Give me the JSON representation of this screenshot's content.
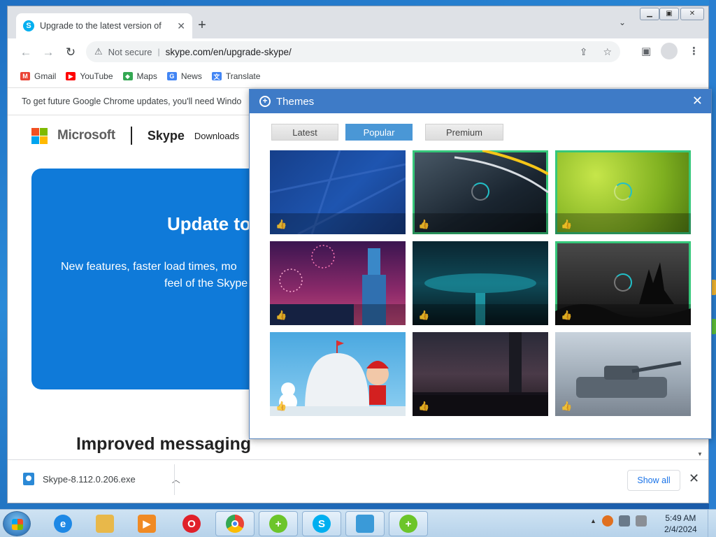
{
  "browser": {
    "tab_title": "Upgrade to the latest version of",
    "new_tab_label": "+",
    "tab_search_label": "⌄",
    "url_security": "Not secure",
    "url": "skype.com/en/upgrade-skype/",
    "bookmarks": [
      {
        "label": "Gmail",
        "color": "#ea4335",
        "glyph": "M"
      },
      {
        "label": "YouTube",
        "color": "#ff0000",
        "glyph": "▶"
      },
      {
        "label": "Maps",
        "color": "#34a853",
        "glyph": "◆"
      },
      {
        "label": "News",
        "color": "#4285f4",
        "glyph": "G"
      },
      {
        "label": "Translate",
        "color": "#4285f4",
        "glyph": "文"
      }
    ],
    "infobar_text": "To get future Google Chrome updates, you'll need Windo"
  },
  "webpage": {
    "brand": "Microsoft",
    "product": "Skype",
    "nav_downloads": "Downloads",
    "hero_title": "Update to",
    "hero_line1": "New features, faster load times, mo",
    "hero_line2": "feel of the Skype",
    "section_title": "Improved messaging"
  },
  "download_bar": {
    "file_name": "Skype-8.112.0.206.exe",
    "show_all": "Show all"
  },
  "themes_dialog": {
    "title": "Themes",
    "tabs": [
      "Latest",
      "Popular",
      "Premium"
    ],
    "active_tab": "Popular",
    "thumbnails": [
      {
        "name": "blue-lines",
        "selected": false,
        "loading": false
      },
      {
        "name": "dark-road",
        "selected": true,
        "loading": true
      },
      {
        "name": "green-meadow",
        "selected": true,
        "loading": true
      },
      {
        "name": "fireworks-tower",
        "selected": false,
        "loading": false
      },
      {
        "name": "teal-city",
        "selected": false,
        "loading": false
      },
      {
        "name": "concert-crowd",
        "selected": true,
        "loading": true
      },
      {
        "name": "snowman-igloo",
        "selected": false,
        "loading": false
      },
      {
        "name": "night-skyline",
        "selected": false,
        "loading": false
      },
      {
        "name": "tank",
        "selected": false,
        "loading": false
      }
    ]
  },
  "taskbar": {
    "time": "5:49 AM",
    "date": "2/4/2024"
  },
  "colors": {
    "themes_header": "#3e7bc7",
    "active_tab": "#4a97d6",
    "selected_border": "#36c77a",
    "hero_blue": "#0f7ad9"
  }
}
